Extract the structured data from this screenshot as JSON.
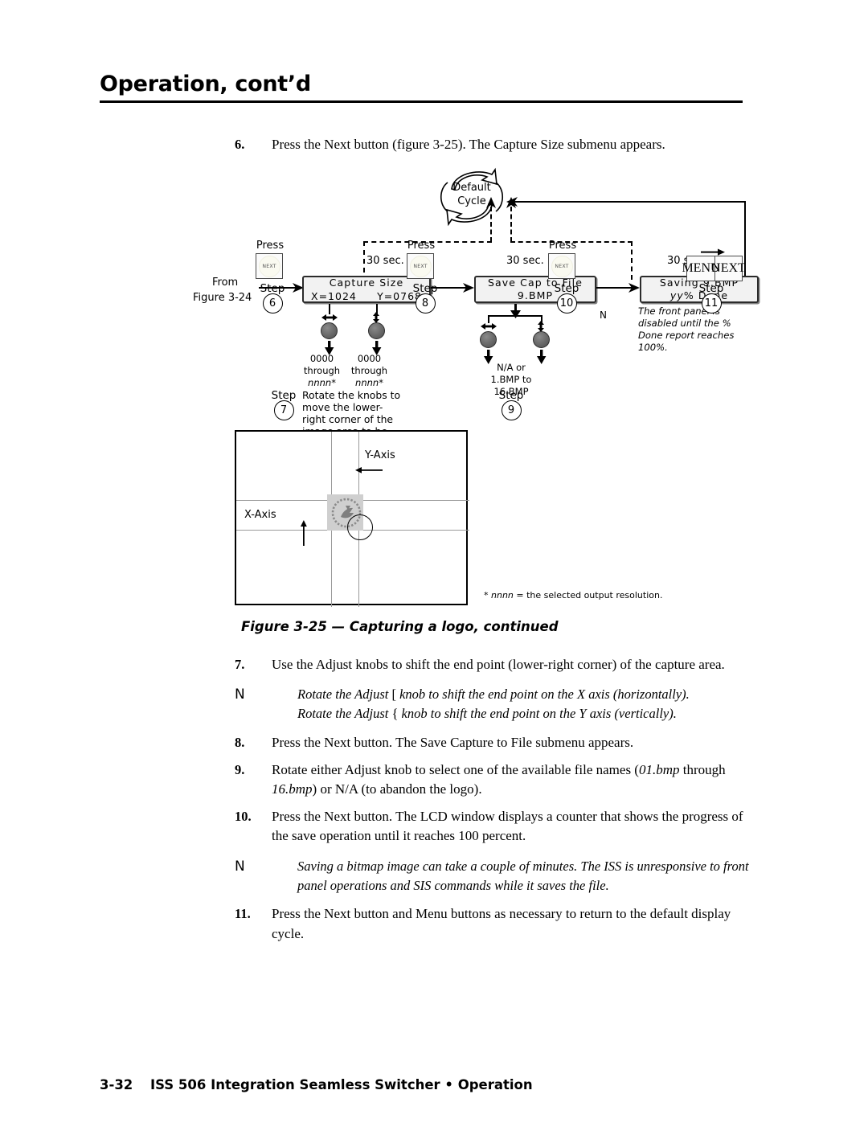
{
  "header": {
    "title": "Operation, cont’d"
  },
  "steps_before": [
    {
      "num": "6.",
      "text": "Press the Next button (figure 3-25).  The Capture Size submenu appears."
    }
  ],
  "figure": {
    "from_line1": "From",
    "from_line2": "Figure 3-24",
    "default_cycle_line1": "Default",
    "default_cycle_line2": "Cycle",
    "press_label": "Press",
    "timeout_label": "30 sec.",
    "button_next": "NEXT",
    "button_menu": "MENU",
    "step_label": "Step",
    "steps": {
      "s6": "6",
      "s7": "7",
      "s8": "8",
      "s9": "9",
      "s10": "10",
      "s11": "11"
    },
    "lcd": {
      "capture_size_title": "Capture Size",
      "capture_size_x": "X=1024",
      "capture_size_y": "Y=0768",
      "save_cap_title": "Save Cap to File",
      "save_cap_value": "9.BMP",
      "saving_title": "Saving 9.BMP",
      "saving_value_ital": "yy",
      "saving_value_rest": "% Done"
    },
    "knob_range_x": [
      "0000",
      "through",
      "nnnn*"
    ],
    "knob_range_y": [
      "0000",
      "through",
      "nnnn*"
    ],
    "file_range": [
      "N/A or",
      "1.BMP to",
      "16.BMP"
    ],
    "step7_note": "Rotate the knobs to move the lower-right corner of the image area to be captured.",
    "saving_note": "The front panel  is disabled until the % Done report reaches 100%.",
    "note_icon": "N",
    "axis_x_label": "X-Axis",
    "axis_y_label": "Y-Axis",
    "footnote_star": "*",
    "footnote_ital": "nnnn",
    "footnote_rest": " = the selected output resolution."
  },
  "figure_caption": "Figure 3-25 — Capturing a logo, continued",
  "steps_after": [
    {
      "num": "7.",
      "text": "Use the Adjust knobs to shift the end point (lower-right corner) of the capture area."
    }
  ],
  "note1": {
    "icon": "N",
    "line1_a": "Rotate the Adjust ",
    "line1_glyph": "[",
    "line1_b": "   knob to shift the end point on the X axis (horizontally).",
    "line2_a": "Rotate the Adjust ",
    "line2_glyph": "{",
    "line2_b": " knob to shift the end point on the Y axis (vertically)."
  },
  "steps_after2": [
    {
      "num": "8.",
      "text": "Press the Next button.  The Save Capture to File submenu appears."
    }
  ],
  "step9": {
    "num": "9.",
    "a": "Rotate either Adjust knob to select one of the available file names (",
    "it1": "01.bmp",
    "b": " through ",
    "it2": "16.bmp",
    "c": ") or N/A (to abandon the logo)."
  },
  "steps_after3": [
    {
      "num": "10.",
      "text": "Press the Next button.  The LCD window displays a counter that shows the progress of the save operation until it reaches 100 percent."
    }
  ],
  "note2": {
    "icon": "N",
    "text": "Saving a bitmap image can take a couple of minutes.  The ISS is unresponsive to front panel operations and SIS commands while it saves the file."
  },
  "steps_after4": [
    {
      "num": "11.",
      "text": "Press the Next button and Menu buttons as necessary to return to the default display cycle."
    }
  ],
  "footer": {
    "page_number": "3-32",
    "text": "ISS 506 Integration Seamless Switcher • Operation"
  }
}
